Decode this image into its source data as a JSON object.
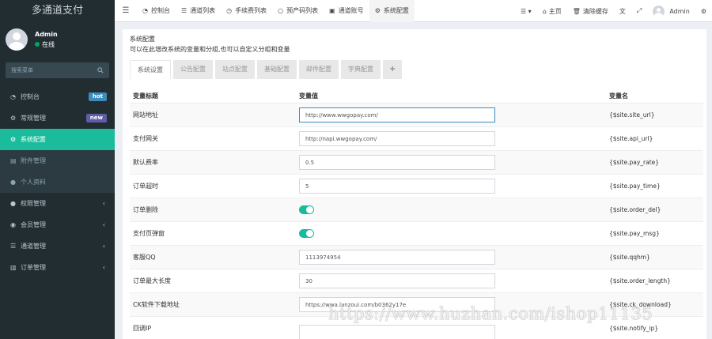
{
  "brand": "多通道支付",
  "user": {
    "name": "Admin",
    "status": "在线"
  },
  "search": {
    "placeholder": "搜索菜单"
  },
  "sidebar": {
    "items": [
      {
        "label": "控制台",
        "icon": "dashboard-icon",
        "badge": "hot"
      },
      {
        "label": "常规管理",
        "icon": "cogs-icon",
        "badge": "new"
      },
      {
        "label": "系统配置",
        "icon": "gear-icon"
      },
      {
        "label": "附件管理",
        "icon": "file-icon"
      },
      {
        "label": "个人资料",
        "icon": "user-icon"
      },
      {
        "label": "权限管理",
        "icon": "group-icon"
      },
      {
        "label": "会员管理",
        "icon": "user-circle-icon"
      },
      {
        "label": "通道管理",
        "icon": "list-icon"
      },
      {
        "label": "订单管理",
        "icon": "bar-chart-icon"
      }
    ]
  },
  "header": {
    "tabs": [
      {
        "label": "控制台",
        "icon": "dashboard-icon"
      },
      {
        "label": "通道列表",
        "icon": "list-icon"
      },
      {
        "label": "手续费列表",
        "icon": "circle-icon"
      },
      {
        "label": "预产码列表",
        "icon": "circle-o-icon"
      },
      {
        "label": "通道账号",
        "icon": "book-icon"
      },
      {
        "label": "系统配置",
        "icon": "gear-icon"
      }
    ],
    "right": {
      "home": "主页",
      "clear_cache": "清除缓存",
      "user": "Admin"
    }
  },
  "panel": {
    "title": "系统配置",
    "desc": "可以在此增改系统的变量和分组,也可以自定义分组和变量",
    "tabs": [
      "系统设置",
      "公告配置",
      "站点配置",
      "基础配置",
      "邮件配置",
      "字典配置"
    ],
    "add_tab": "+"
  },
  "table": {
    "headers": [
      "变量标题",
      "变量值",
      "变量名"
    ],
    "rows": [
      {
        "title": "网站地址",
        "type": "text",
        "value": "http://www.wwgopay.com/",
        "name": "{$site.site_url}"
      },
      {
        "title": "支付网关",
        "type": "text",
        "value": "http://napi.wwgopay.com/",
        "name": "{$site.api_url}"
      },
      {
        "title": "默认费率",
        "type": "text",
        "value": "0.5",
        "name": "{$site.pay_rate}"
      },
      {
        "title": "订单超时",
        "type": "text",
        "value": "5",
        "name": "{$site.pay_time}"
      },
      {
        "title": "订单删除",
        "type": "switch",
        "value": "on",
        "name": "{$site.order_del}"
      },
      {
        "title": "支付页弹窗",
        "type": "switch",
        "value": "on",
        "name": "{$site.pay_msg}"
      },
      {
        "title": "客服QQ",
        "type": "text",
        "value": "1113974954",
        "name": "{$site.qqhm}"
      },
      {
        "title": "订单最大长度",
        "type": "text",
        "value": "30",
        "name": "{$site.order_length}"
      },
      {
        "title": "CK软件下载地址",
        "type": "text",
        "value": "https://wwa.lanzoui.com/b0362y17e",
        "name": "{$site.ck_download}"
      },
      {
        "title": "回调IP",
        "type": "text",
        "value": "",
        "name": "{$site.notify_ip}"
      }
    ]
  },
  "watermark": "https://www.huzhan.com/ishop11135",
  "colors": {
    "sidebar": "#222d32",
    "active": "#1abc9c",
    "switch": "#18bc9c",
    "badge_hot": "#3c8dbc",
    "badge_new": "#605ca8"
  }
}
